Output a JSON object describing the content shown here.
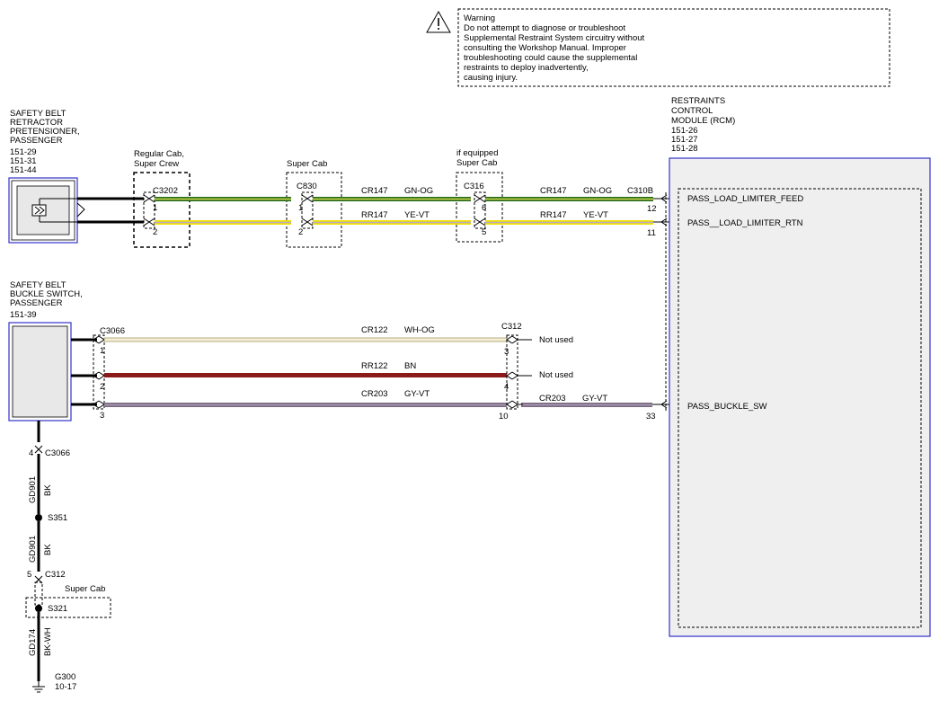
{
  "warning": {
    "icon": "warning-triangle-icon",
    "lines": [
      "Warning",
      "Do not attempt to diagnose or troubleshoot",
      "Supplemental Restraint System circuitry without",
      "consulting the Workshop Manual. Improper",
      "troubleshooting could cause the supplemental",
      "restraints to deploy inadvertently,",
      "causing injury."
    ]
  },
  "retractor": {
    "name_lines": [
      "SAFETY BELT",
      "RETRACTOR",
      "PRETENSIONER,",
      "PASSENGER"
    ],
    "refs": [
      "151-29",
      "151-31",
      "151-44"
    ]
  },
  "buckle": {
    "name_lines": [
      "SAFETY BELT",
      "BUCKLE SWITCH,",
      "PASSENGER"
    ],
    "refs": [
      "151-39"
    ]
  },
  "rcm": {
    "name_lines": [
      "RESTRAINTS",
      "CONTROL",
      "MODULE (RCM)"
    ],
    "refs": [
      "151-26",
      "151-27",
      "151-28"
    ],
    "signals": [
      "PASS_LOAD_LIMITER_FEED",
      "PASS__LOAD_LIMITER_RTN",
      "PASS_BUCKLE_SW"
    ]
  },
  "connectors": {
    "c3202": {
      "name": "C3202",
      "note": [
        "Regular Cab,",
        "Super Crew"
      ],
      "pins": [
        "1",
        "2"
      ]
    },
    "c830": {
      "name": "C830",
      "note": [
        "Super Cab"
      ],
      "pins": [
        "1",
        "2"
      ]
    },
    "c316": {
      "name": "C316",
      "note": [
        "if equipped",
        "Super Cab"
      ],
      "pins": [
        "6",
        "5"
      ]
    },
    "c310b": {
      "name": "C310B",
      "pins": [
        "12",
        "11"
      ]
    },
    "c3066": {
      "name": "C3066",
      "pins": [
        "1",
        "2",
        "3"
      ]
    },
    "c312": {
      "name": "C312",
      "pins": [
        "3",
        "4",
        "10"
      ]
    },
    "rcm_buckle": {
      "pins": [
        "33"
      ]
    },
    "c3066_ground": {
      "name": "C3066",
      "pin": "4"
    },
    "c312_ground": {
      "name": "C312",
      "pin": "5"
    }
  },
  "wires": {
    "cr147": {
      "circuit": "CR147",
      "color": "GN-OG",
      "stripe": [
        "#2c6b1f",
        "#c8d648"
      ]
    },
    "rr147": {
      "circuit": "RR147",
      "color": "YE-VT",
      "stripe": [
        "#f2e200",
        "#b8a9c9"
      ]
    },
    "cr122": {
      "circuit": "CR122",
      "color": "WH-OG",
      "stripe": [
        "#f4f0d8",
        "#8a7a3c"
      ]
    },
    "rr122": {
      "circuit": "RR122",
      "color": "BN",
      "stripe": [
        "#8b1a1a",
        "#8b1a1a"
      ]
    },
    "cr203": {
      "circuit": "CR203",
      "color": "GY-VT",
      "stripe": [
        "#7a6a82",
        "#a89ab0"
      ]
    },
    "gd901": {
      "circuit": "GD901",
      "color": "BK"
    },
    "gd174": {
      "circuit": "GD174",
      "color": "BK-WH"
    }
  },
  "not_used": "Not used",
  "splices": {
    "s351": "S351",
    "s321": "S321",
    "s321_note": "Super Cab"
  },
  "ground": {
    "name": "G300",
    "ref": "10-17"
  }
}
